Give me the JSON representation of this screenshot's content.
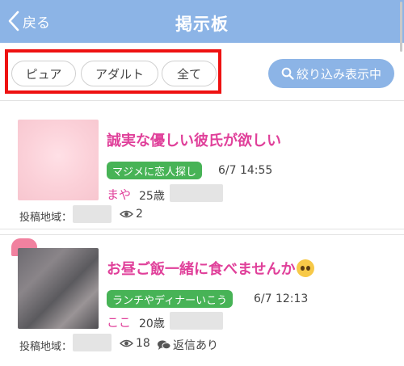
{
  "header": {
    "back_label": "戻る",
    "title": "掲示板"
  },
  "filters": {
    "items": [
      "ピュア",
      "アダルト",
      "全て"
    ],
    "search_button": "絞り込み表示中"
  },
  "posts": [
    {
      "title": "誠実な優しい彼氏が欲しい",
      "tag": "マジメに恋人探し",
      "date": "6/7 14:55",
      "author": "まや",
      "age": "25歳",
      "region_label": "投稿地域：",
      "views": "2",
      "reply": ""
    },
    {
      "title": "お昼ご飯一緒に食べませんか",
      "tag": "ランチやディナーいこう",
      "date": "6/7 12:13",
      "author": "ここ",
      "age": "20歳",
      "region_label": "投稿地域：",
      "views": "18",
      "reply": "返信あり"
    }
  ],
  "colors": {
    "header": "#8cb4e6",
    "title_pink": "#e0409a",
    "tag_green": "#47b356",
    "highlight": "#ee1111"
  },
  "icons": {
    "back": "chevron-left-icon",
    "search": "search-icon",
    "views": "eye-icon",
    "reply": "chat-bubbles-icon",
    "emoji": "pleading-face-icon"
  }
}
